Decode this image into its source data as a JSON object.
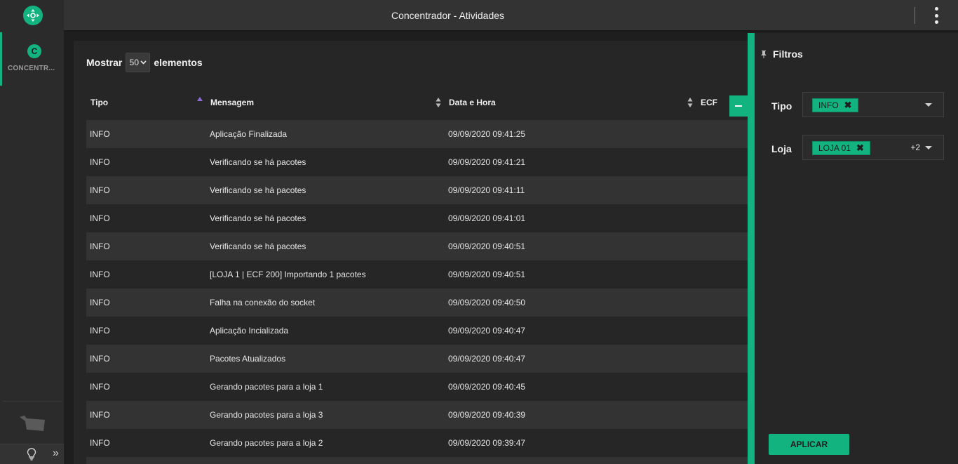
{
  "header": {
    "title": "Concentrador - Atividades"
  },
  "sidebar": {
    "item_initial": "C",
    "item_label": "CONCENTR..."
  },
  "table_controls": {
    "show_label": "Mostrar",
    "page_size": "50",
    "elements_label": "elementos"
  },
  "columns": {
    "tipo": "Tipo",
    "mensagem": "Mensagem",
    "data_hora": "Data e Hora",
    "ecf": "ECF"
  },
  "rows": [
    {
      "tipo": "INFO",
      "mensagem": "Aplicação Finalizada",
      "data_hora": "09/09/2020 09:41:25"
    },
    {
      "tipo": "INFO",
      "mensagem": "Verificando se há pacotes",
      "data_hora": "09/09/2020 09:41:21"
    },
    {
      "tipo": "INFO",
      "mensagem": "Verificando se há pacotes",
      "data_hora": "09/09/2020 09:41:11"
    },
    {
      "tipo": "INFO",
      "mensagem": "Verificando se há pacotes",
      "data_hora": "09/09/2020 09:41:01"
    },
    {
      "tipo": "INFO",
      "mensagem": "Verificando se há pacotes",
      "data_hora": "09/09/2020 09:40:51"
    },
    {
      "tipo": "INFO",
      "mensagem": "[LOJA 1 | ECF 200] Importando 1 pacotes",
      "data_hora": "09/09/2020 09:40:51"
    },
    {
      "tipo": "INFO",
      "mensagem": "Falha na conexão do socket",
      "data_hora": "09/09/2020 09:40:50"
    },
    {
      "tipo": "INFO",
      "mensagem": "Aplicação Incializada",
      "data_hora": "09/09/2020 09:40:47"
    },
    {
      "tipo": "INFO",
      "mensagem": "Pacotes Atualizados",
      "data_hora": "09/09/2020 09:40:47"
    },
    {
      "tipo": "INFO",
      "mensagem": "Gerando pacotes para a loja 1",
      "data_hora": "09/09/2020 09:40:45"
    },
    {
      "tipo": "INFO",
      "mensagem": "Gerando pacotes para a loja 3",
      "data_hora": "09/09/2020 09:40:39"
    },
    {
      "tipo": "INFO",
      "mensagem": "Gerando pacotes para a loja 2",
      "data_hora": "09/09/2020 09:39:47"
    },
    {
      "tipo": "",
      "mensagem": "",
      "data_hora": ""
    }
  ],
  "filters": {
    "title": "Filtros",
    "tipo_label": "Tipo",
    "tipo_chip": "INFO",
    "loja_label": "Loja",
    "loja_chip": "LOJA 01",
    "loja_more": "+2",
    "apply_label": "APLICAR"
  },
  "colors": {
    "accent": "#13b37f",
    "sort_active": "#8e6ad8",
    "background": "#1e1e1e"
  },
  "icons": {
    "logo": "crosshair-arrows-icon",
    "pin": "pin-icon",
    "remove_chip": "close-icon",
    "menu": "kebab-menu-icon",
    "bulb": "lightbulb-icon",
    "expand": "double-chevron-right-icon",
    "collapse": "minus-icon"
  }
}
